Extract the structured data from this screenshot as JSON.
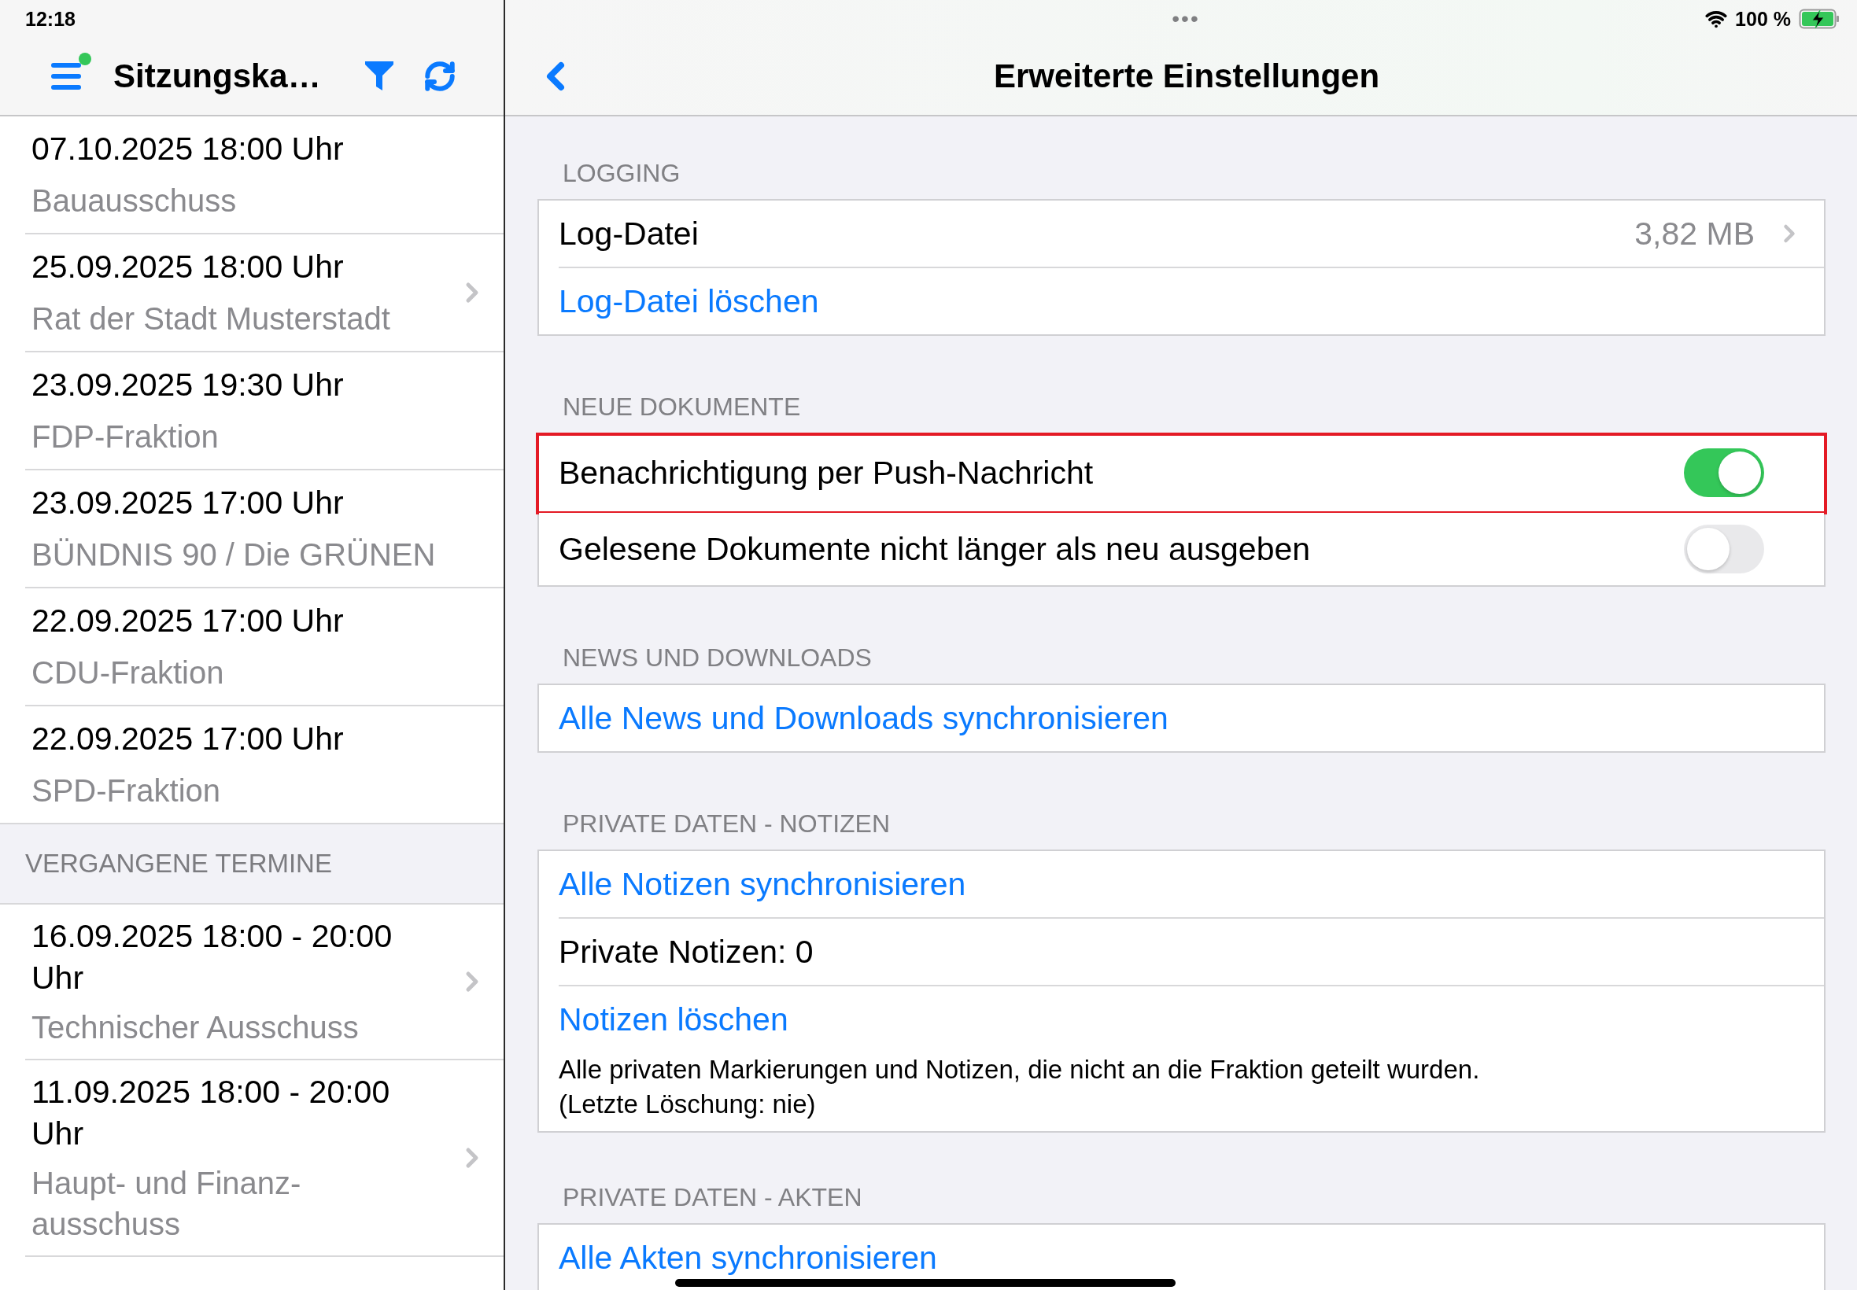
{
  "status_bar": {
    "time": "12:18",
    "multitasking": "•••",
    "battery": "100 %"
  },
  "sidebar": {
    "title": "Sitzungska…",
    "menu_badge": true,
    "upcoming": [
      {
        "date": "07.10.2025 18:00 Uhr",
        "name": "Bauausschuss",
        "disclosure": false
      },
      {
        "date": "25.09.2025 18:00 Uhr",
        "name": "Rat der Stadt Musterstadt",
        "disclosure": true
      },
      {
        "date": "23.09.2025 19:30 Uhr",
        "name": "FDP-Fraktion",
        "disclosure": false
      },
      {
        "date": "23.09.2025 17:00 Uhr",
        "name": "BÜNDNIS 90 / Die GRÜNEN",
        "disclosure": false
      },
      {
        "date": "22.09.2025 17:00 Uhr",
        "name": "CDU-Fraktion",
        "disclosure": false
      },
      {
        "date": "22.09.2025 17:00 Uhr",
        "name": "SPD-Fraktion",
        "disclosure": false
      }
    ],
    "past_header": "VERGANGENE TERMINE",
    "past": [
      {
        "date": "16.09.2025 18:00 - 20:00 Uhr",
        "name": "Technischer Ausschuss",
        "disclosure": true
      },
      {
        "date": "11.09.2025 18:00 - 20:00 Uhr",
        "name": "Haupt- und Finanz-ausschuss",
        "disclosure": true
      }
    ]
  },
  "detail": {
    "title": "Erweiterte Einstellungen",
    "sections": [
      {
        "header": "LOGGING",
        "rows": [
          {
            "kind": "detail",
            "label": "Log-Datei",
            "value": "3,82 MB"
          },
          {
            "kind": "action",
            "label": "Log-Datei löschen"
          }
        ]
      },
      {
        "header": "NEUE DOKUMENTE",
        "rows": [
          {
            "kind": "toggle",
            "label": "Benachrichtigung per Push-Nachricht",
            "on": true,
            "highlighted": true
          },
          {
            "kind": "toggle",
            "label": "Gelesene Dokumente nicht länger als neu ausgeben",
            "on": false,
            "highlighted": false
          }
        ]
      },
      {
        "header": "NEWS UND DOWNLOADS",
        "rows": [
          {
            "kind": "action",
            "label": "Alle News und Downloads synchronisieren"
          }
        ]
      },
      {
        "header": "PRIVATE DATEN - NOTIZEN",
        "rows": [
          {
            "kind": "action",
            "label": "Alle Notizen synchronisieren"
          },
          {
            "kind": "text",
            "label": "Private Notizen: 0"
          },
          {
            "kind": "action",
            "label": "Notizen löschen",
            "description": "Alle privaten Markierungen und Notizen, die nicht an die Fraktion geteilt wurden.\n(Letzte Löschung: nie)"
          }
        ]
      },
      {
        "header": "PRIVATE DATEN - AKTEN",
        "rows": [
          {
            "kind": "action",
            "label": "Alle Akten synchronisieren"
          }
        ]
      }
    ]
  }
}
